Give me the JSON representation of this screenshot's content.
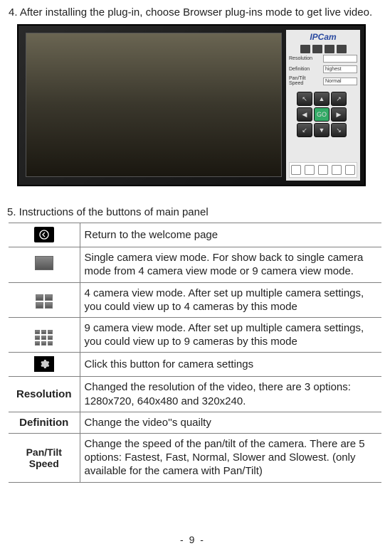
{
  "step4": {
    "text": "4. After installing the plug-in, choose Browser plug-ins mode to get live video."
  },
  "screenshot": {
    "title": "IPCam",
    "settings": {
      "resolution_label": "Resolution",
      "definition_label": "Definition",
      "definition_value": "highest",
      "pantilt_label": "Pan/Tilt Speed",
      "pantilt_value": "Normal"
    }
  },
  "step5": {
    "text": "5. Instructions of the buttons of main panel"
  },
  "table": {
    "row1": {
      "desc": "Return to the welcome page"
    },
    "row2": {
      "desc": "Single camera view mode. For show back to single camera mode from 4 camera view mode or 9 camera view mode."
    },
    "row3": {
      "desc": "4 camera view mode. After set up multiple camera settings, you could view up to 4 cameras by this mode"
    },
    "row4": {
      "desc": "9 camera view mode. After set up multiple camera settings, you could view up to 9 cameras by this mode"
    },
    "row5": {
      "desc": "Click this button for camera settings"
    },
    "row6": {
      "label": "Resolution",
      "desc": "Changed the resolution of the video, there are 3 options: 1280x720, 640x480 and 320x240."
    },
    "row7": {
      "label": "Definition",
      "desc": "Change the video''s quailty"
    },
    "row8": {
      "label": "Pan/Tilt Speed",
      "desc": "Change the speed of the pan/tilt of the camera. There are 5 options: Fastest, Fast, Normal, Slower and Slowest. (only available for the camera with Pan/Tilt)"
    }
  },
  "page_number": "- 9 -"
}
